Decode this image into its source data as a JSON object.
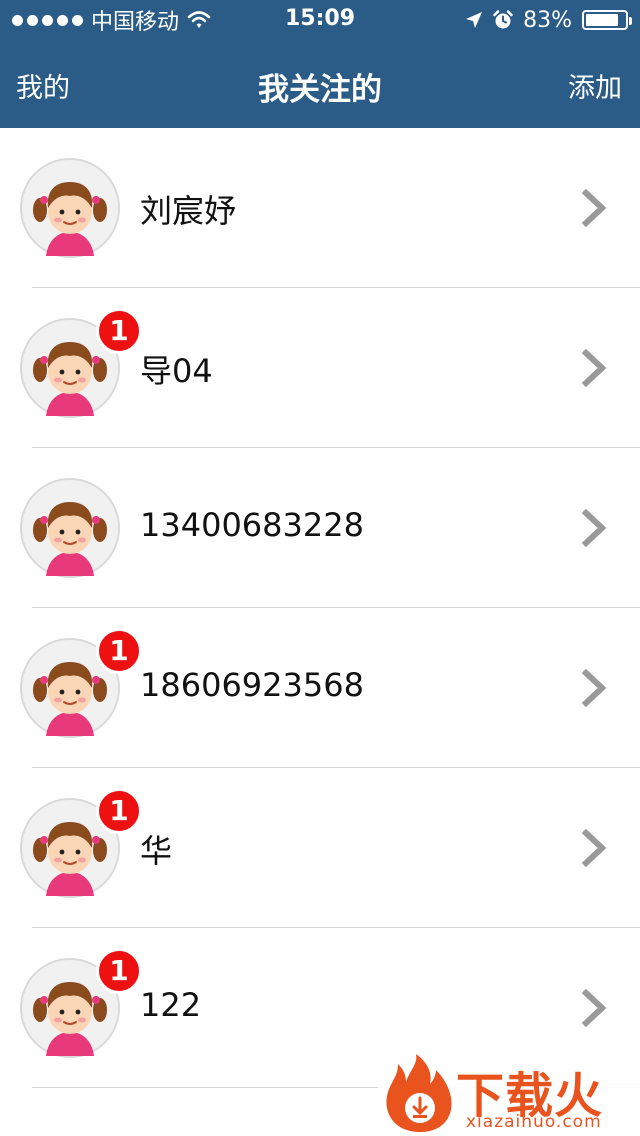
{
  "status_bar": {
    "carrier": "中国移动",
    "time": "15:09",
    "battery_percent": "83%",
    "battery_level": 0.83,
    "icons": [
      "signal-dots-icon",
      "wifi-icon",
      "location-arrow-icon",
      "alarm-icon",
      "battery-icon"
    ]
  },
  "nav": {
    "left_label": "我的",
    "title": "我关注的",
    "right_label": "添加"
  },
  "contacts": [
    {
      "name": "刘宸妤",
      "badge": ""
    },
    {
      "name": "导04",
      "badge": "1"
    },
    {
      "name": "13400683228",
      "badge": ""
    },
    {
      "name": "18606923568",
      "badge": "1"
    },
    {
      "name": "华",
      "badge": "1"
    },
    {
      "name": "122",
      "badge": "1"
    }
  ],
  "watermark": {
    "text": "下载火",
    "url": "xiazaihuo.com"
  },
  "colors": {
    "nav_bg": "#2b5c87",
    "badge": "#ee1111",
    "watermark": "#e9531e"
  }
}
